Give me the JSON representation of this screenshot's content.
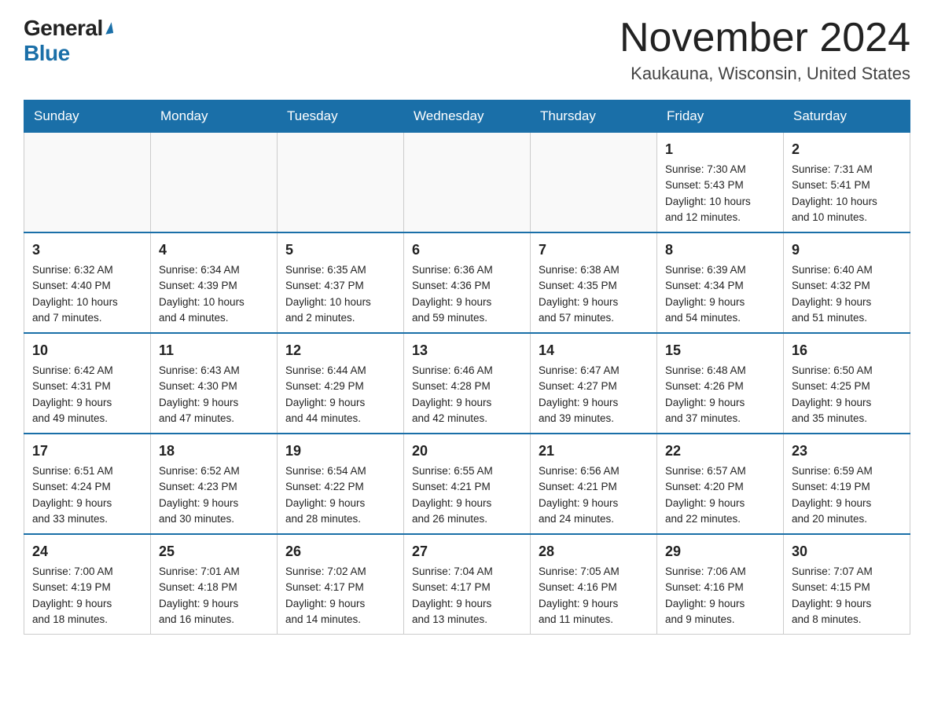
{
  "logo": {
    "general": "General",
    "blue": "Blue"
  },
  "title": {
    "month": "November 2024",
    "location": "Kaukauna, Wisconsin, United States"
  },
  "weekdays": [
    "Sunday",
    "Monday",
    "Tuesday",
    "Wednesday",
    "Thursday",
    "Friday",
    "Saturday"
  ],
  "weeks": [
    [
      {
        "day": "",
        "info": ""
      },
      {
        "day": "",
        "info": ""
      },
      {
        "day": "",
        "info": ""
      },
      {
        "day": "",
        "info": ""
      },
      {
        "day": "",
        "info": ""
      },
      {
        "day": "1",
        "info": "Sunrise: 7:30 AM\nSunset: 5:43 PM\nDaylight: 10 hours\nand 12 minutes."
      },
      {
        "day": "2",
        "info": "Sunrise: 7:31 AM\nSunset: 5:41 PM\nDaylight: 10 hours\nand 10 minutes."
      }
    ],
    [
      {
        "day": "3",
        "info": "Sunrise: 6:32 AM\nSunset: 4:40 PM\nDaylight: 10 hours\nand 7 minutes."
      },
      {
        "day": "4",
        "info": "Sunrise: 6:34 AM\nSunset: 4:39 PM\nDaylight: 10 hours\nand 4 minutes."
      },
      {
        "day": "5",
        "info": "Sunrise: 6:35 AM\nSunset: 4:37 PM\nDaylight: 10 hours\nand 2 minutes."
      },
      {
        "day": "6",
        "info": "Sunrise: 6:36 AM\nSunset: 4:36 PM\nDaylight: 9 hours\nand 59 minutes."
      },
      {
        "day": "7",
        "info": "Sunrise: 6:38 AM\nSunset: 4:35 PM\nDaylight: 9 hours\nand 57 minutes."
      },
      {
        "day": "8",
        "info": "Sunrise: 6:39 AM\nSunset: 4:34 PM\nDaylight: 9 hours\nand 54 minutes."
      },
      {
        "day": "9",
        "info": "Sunrise: 6:40 AM\nSunset: 4:32 PM\nDaylight: 9 hours\nand 51 minutes."
      }
    ],
    [
      {
        "day": "10",
        "info": "Sunrise: 6:42 AM\nSunset: 4:31 PM\nDaylight: 9 hours\nand 49 minutes."
      },
      {
        "day": "11",
        "info": "Sunrise: 6:43 AM\nSunset: 4:30 PM\nDaylight: 9 hours\nand 47 minutes."
      },
      {
        "day": "12",
        "info": "Sunrise: 6:44 AM\nSunset: 4:29 PM\nDaylight: 9 hours\nand 44 minutes."
      },
      {
        "day": "13",
        "info": "Sunrise: 6:46 AM\nSunset: 4:28 PM\nDaylight: 9 hours\nand 42 minutes."
      },
      {
        "day": "14",
        "info": "Sunrise: 6:47 AM\nSunset: 4:27 PM\nDaylight: 9 hours\nand 39 minutes."
      },
      {
        "day": "15",
        "info": "Sunrise: 6:48 AM\nSunset: 4:26 PM\nDaylight: 9 hours\nand 37 minutes."
      },
      {
        "day": "16",
        "info": "Sunrise: 6:50 AM\nSunset: 4:25 PM\nDaylight: 9 hours\nand 35 minutes."
      }
    ],
    [
      {
        "day": "17",
        "info": "Sunrise: 6:51 AM\nSunset: 4:24 PM\nDaylight: 9 hours\nand 33 minutes."
      },
      {
        "day": "18",
        "info": "Sunrise: 6:52 AM\nSunset: 4:23 PM\nDaylight: 9 hours\nand 30 minutes."
      },
      {
        "day": "19",
        "info": "Sunrise: 6:54 AM\nSunset: 4:22 PM\nDaylight: 9 hours\nand 28 minutes."
      },
      {
        "day": "20",
        "info": "Sunrise: 6:55 AM\nSunset: 4:21 PM\nDaylight: 9 hours\nand 26 minutes."
      },
      {
        "day": "21",
        "info": "Sunrise: 6:56 AM\nSunset: 4:21 PM\nDaylight: 9 hours\nand 24 minutes."
      },
      {
        "day": "22",
        "info": "Sunrise: 6:57 AM\nSunset: 4:20 PM\nDaylight: 9 hours\nand 22 minutes."
      },
      {
        "day": "23",
        "info": "Sunrise: 6:59 AM\nSunset: 4:19 PM\nDaylight: 9 hours\nand 20 minutes."
      }
    ],
    [
      {
        "day": "24",
        "info": "Sunrise: 7:00 AM\nSunset: 4:19 PM\nDaylight: 9 hours\nand 18 minutes."
      },
      {
        "day": "25",
        "info": "Sunrise: 7:01 AM\nSunset: 4:18 PM\nDaylight: 9 hours\nand 16 minutes."
      },
      {
        "day": "26",
        "info": "Sunrise: 7:02 AM\nSunset: 4:17 PM\nDaylight: 9 hours\nand 14 minutes."
      },
      {
        "day": "27",
        "info": "Sunrise: 7:04 AM\nSunset: 4:17 PM\nDaylight: 9 hours\nand 13 minutes."
      },
      {
        "day": "28",
        "info": "Sunrise: 7:05 AM\nSunset: 4:16 PM\nDaylight: 9 hours\nand 11 minutes."
      },
      {
        "day": "29",
        "info": "Sunrise: 7:06 AM\nSunset: 4:16 PM\nDaylight: 9 hours\nand 9 minutes."
      },
      {
        "day": "30",
        "info": "Sunrise: 7:07 AM\nSunset: 4:15 PM\nDaylight: 9 hours\nand 8 minutes."
      }
    ]
  ]
}
